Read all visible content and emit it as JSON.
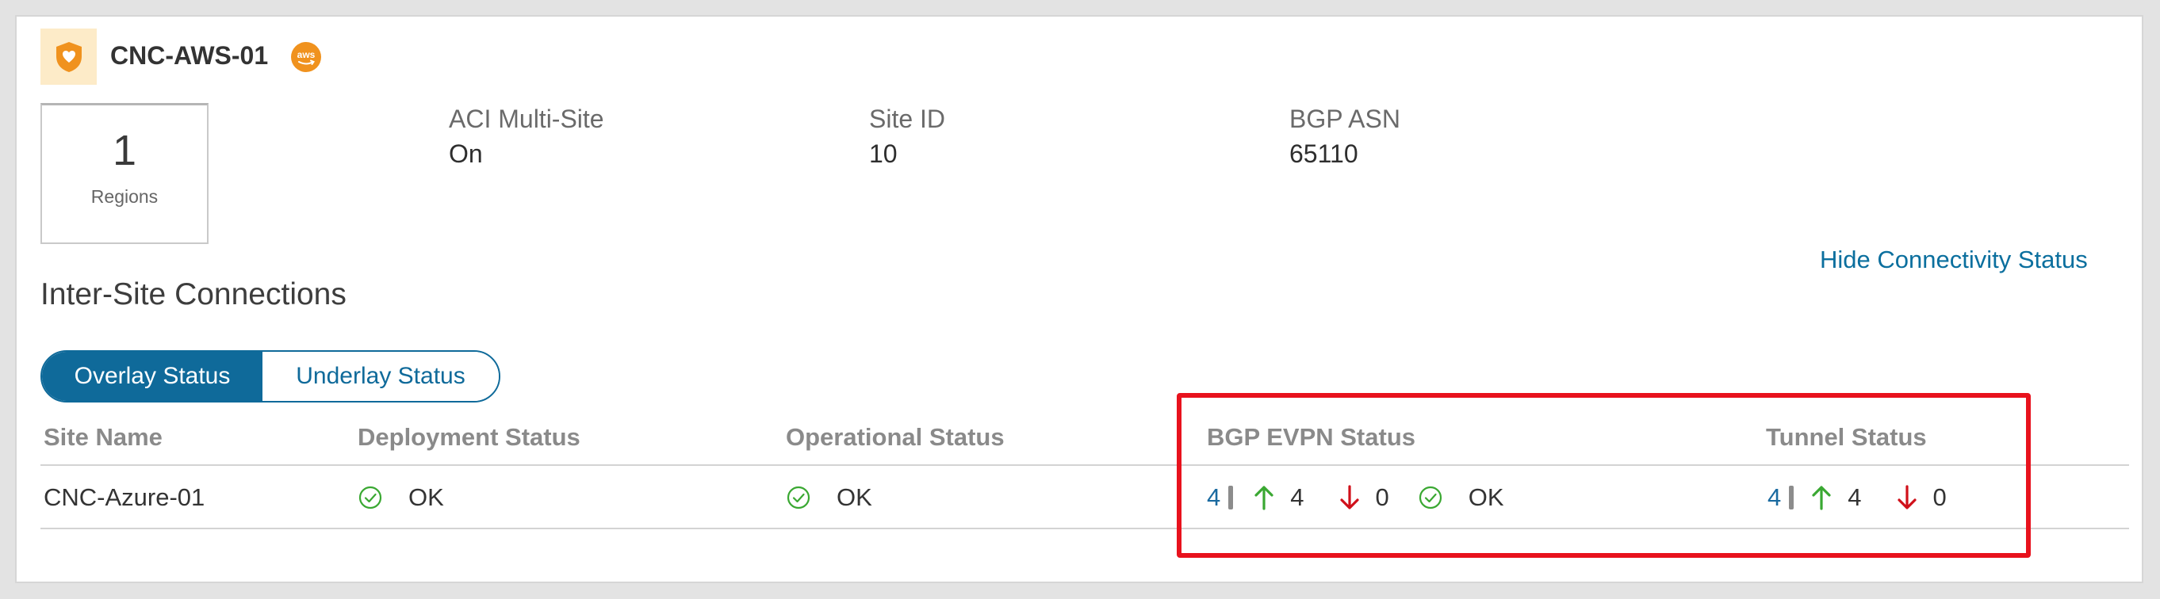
{
  "site": {
    "name": "CNC-AWS-01",
    "badge": "aws",
    "regions_count": "1",
    "regions_label": "Regions"
  },
  "info": [
    {
      "label": "ACI Multi-Site",
      "value": "On"
    },
    {
      "label": "Site ID",
      "value": "10"
    },
    {
      "label": "BGP ASN",
      "value": "65110"
    }
  ],
  "hide_link": "Hide Connectivity Status",
  "section_title": "Inter-Site Connections",
  "tabs": [
    {
      "label": "Overlay Status",
      "active": true
    },
    {
      "label": "Underlay Status",
      "active": false
    }
  ],
  "table": {
    "headers": [
      "Site Name",
      "Deployment Status",
      "Operational Status",
      "BGP EVPN Status",
      "Tunnel Status"
    ],
    "rows": [
      {
        "site_name": "CNC-Azure-01",
        "deployment_status": "OK",
        "operational_status": "OK",
        "bgp_evpn": {
          "total": "4",
          "up": "4",
          "down": "0",
          "status": "OK"
        },
        "tunnel": {
          "total": "4",
          "up": "4",
          "down": "0"
        }
      }
    ]
  },
  "colors": {
    "accent": "#0f6a9a",
    "ok_green": "#3aa832",
    "down_red": "#d0101a",
    "highlight": "#e8121d",
    "site_icon_bg": "#fdebc8",
    "aws_orange": "#f0921e"
  }
}
